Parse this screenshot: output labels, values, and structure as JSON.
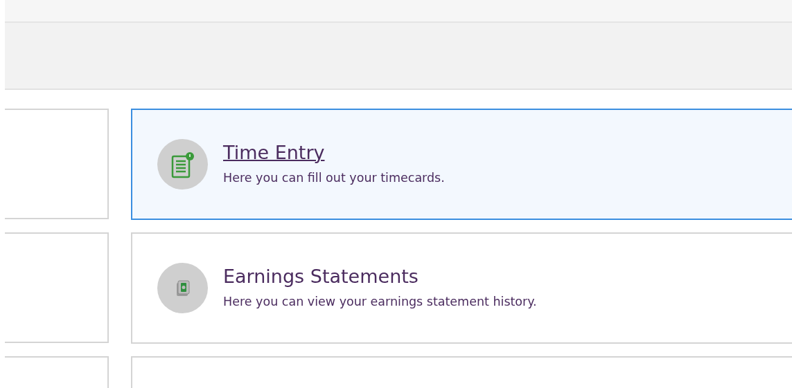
{
  "cards": [
    {
      "title": "Time Entry",
      "description": "Here you can fill out your timecards.",
      "kind": "timecard",
      "selected": true
    },
    {
      "title": "Earnings Statements",
      "description": "Here you can view your earnings statement history.",
      "kind": "money",
      "selected": false
    }
  ]
}
